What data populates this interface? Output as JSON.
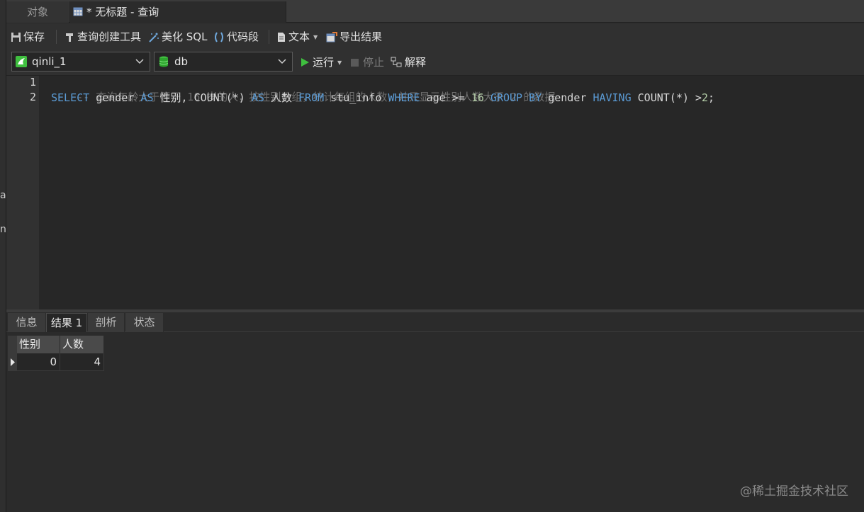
{
  "tabs": {
    "objects_label": "对象",
    "query_label": "* 无标题 - 查询"
  },
  "toolbar": {
    "save_label": "保存",
    "query_builder_label": "查询创建工具",
    "beautify_label": "美化 SQL",
    "snippet_label": "代码段",
    "text_label": "文本",
    "export_label": "导出结果"
  },
  "connection": {
    "connection_value": "qinli_1",
    "database_value": "db",
    "run_label": "运行",
    "stop_label": "停止",
    "explain_label": "解释"
  },
  "editor": {
    "line_numbers": [
      "1",
      "2"
    ],
    "line1_comment": "-- 查询年龄大于等于 16 岁的人，按性别分组，统计每组的人数，并只显示性别人数大于 2 的数据",
    "line2": {
      "t1": "SELECT",
      "t2": " gender ",
      "t3": "AS",
      "t4": " 性别, COUNT(*) ",
      "t5": "AS",
      "t6": " 人数 ",
      "t7": "FROM",
      "t8": " stu_info ",
      "t9": "WHERE",
      "t10": " age >= ",
      "t11": "16",
      "t12": " ",
      "t13": "GROUP BY",
      "t14": " gender ",
      "t15": "HAVING",
      "t16": " COUNT(*) >",
      "t17": "2",
      "t18": ";"
    }
  },
  "result_tabs": {
    "info": "信息",
    "result1": "结果 1",
    "profile": "剖析",
    "status": "状态"
  },
  "result_grid": {
    "columns": [
      "性别",
      "人数"
    ],
    "rows": [
      [
        "0",
        "4"
      ]
    ]
  },
  "left_edge": {
    "char1": "a",
    "char2": "n"
  },
  "watermark": "@稀土掘金技术社区",
  "colors": {
    "keyword": "#5b9bd5",
    "comment": "#6f6f6f",
    "number": "#b5cea8",
    "run_green": "#3fbf3f"
  }
}
